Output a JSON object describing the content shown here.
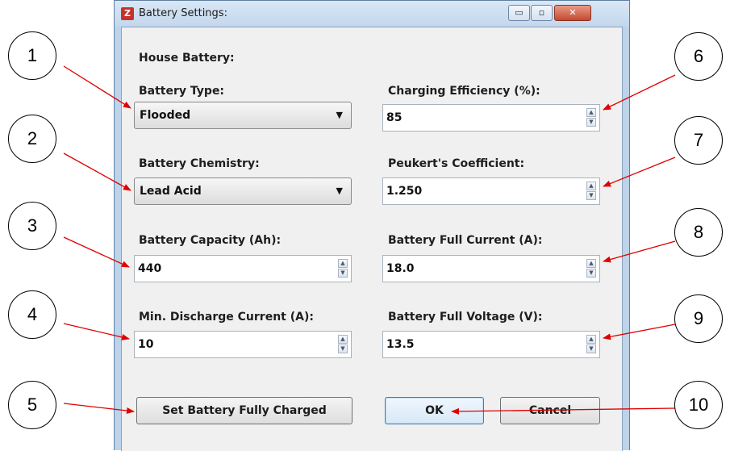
{
  "window": {
    "title": "Battery Settings:",
    "app_icon": "cz-logo-icon",
    "controls": {
      "minimize": "▭",
      "maximize": "▫",
      "close": "✕"
    }
  },
  "form": {
    "section_title": "House Battery:",
    "battery_type": {
      "label": "Battery Type:",
      "value": "Flooded"
    },
    "battery_chemistry": {
      "label": "Battery Chemistry:",
      "value": "Lead Acid"
    },
    "battery_capacity": {
      "label": "Battery Capacity (Ah):",
      "value": "440"
    },
    "min_discharge_current": {
      "label": "Min. Discharge Current (A):",
      "value": "10"
    },
    "charging_efficiency": {
      "label": "Charging Efficiency (%):",
      "value": "85"
    },
    "peukert_coefficient": {
      "label": "Peukert's Coefficient:",
      "value": "1.250"
    },
    "battery_full_current": {
      "label": "Battery Full Current (A):",
      "value": "18.0"
    },
    "battery_full_voltage": {
      "label": "Battery Full Voltage (V):",
      "value": "13.5"
    }
  },
  "buttons": {
    "set_fully_charged": "Set Battery Fully Charged",
    "ok": "OK",
    "cancel": "Cancel"
  },
  "callouts": [
    "1",
    "2",
    "3",
    "4",
    "5",
    "6",
    "7",
    "8",
    "9",
    "10"
  ],
  "colors": {
    "arrow": "#e00000",
    "window_frame": "#bcd3ea",
    "dialog_bg": "#f0f0f0"
  }
}
